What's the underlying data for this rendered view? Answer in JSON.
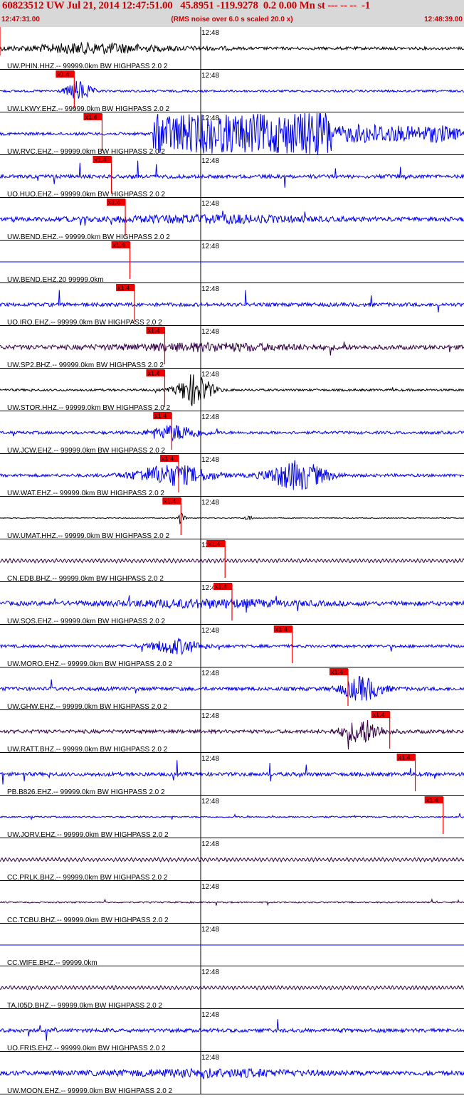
{
  "header": {
    "title": "60823512 UW Jul 21, 2014 12:47:51.00   45.8951 -119.9278  0.2 0.00 Mn st --- -- --  -1",
    "start_time": "12:47:31.00",
    "rms_note": "(RMS noise over 6.0 s scaled 20.0 x)",
    "end_time": "12:48:39.00",
    "background": "#d8d8d8",
    "text_color": "#cc0000"
  },
  "minute_tick_label": "12:48",
  "pick_label": "x1.4",
  "colors": {
    "blue": "#0000ee",
    "black": "#000000",
    "purple": "#330044",
    "pick": "#ee0000",
    "grid": "#000000"
  },
  "traces": [
    {
      "label": "UW.PHIN.HHZ.-- 99999.0km BW  HIGHPASS  2.0  2",
      "color": "black",
      "pick": 0.0,
      "pick_label": false,
      "activity": "early"
    },
    {
      "label": "UW.LKWY.EHZ.-- 99999.0km BW  HIGHPASS  2.0  2",
      "color": "blue",
      "pick": 0.16,
      "pick_label": true,
      "activity": "burst"
    },
    {
      "label": "UW.RVC.EHZ.-- 99999.0km BW  HIGHPASS  2.0  2",
      "color": "blue",
      "pick": 0.22,
      "pick_label": true,
      "activity": "large"
    },
    {
      "label": "UO.HUO.EHZ.-- 99999.0km BW  HIGHPASS  2.0  2",
      "color": "blue",
      "pick": 0.24,
      "pick_label": true,
      "activity": "spiky"
    },
    {
      "label": "UW.BEND.EHZ.-- 99999.0km BW  HIGHPASS  2.0  2",
      "color": "blue",
      "pick": 0.27,
      "pick_label": true,
      "activity": "moderate"
    },
    {
      "label": "UW.BEND.EHZ.20 99999.0km",
      "color": "blue",
      "pick": 0.28,
      "pick_label": true,
      "activity": "flat"
    },
    {
      "label": "UO.IRO.EHZ.-- 99999.0km BW  HIGHPASS  2.0  2",
      "color": "blue",
      "pick": 0.29,
      "pick_label": true,
      "activity": "spiky"
    },
    {
      "label": "UW.SP2.BHZ.-- 99999.0km BW  HIGHPASS  2.0  2",
      "color": "purple",
      "pick": 0.355,
      "pick_label": true,
      "activity": "moderate"
    },
    {
      "label": "UW.STOR.HHZ.-- 99999.0km BW  HIGHPASS  2.0  2",
      "color": "black",
      "pick": 0.355,
      "pick_label": true,
      "activity": "event"
    },
    {
      "label": "UW.JCW.EHZ.-- 99999.0km BW  HIGHPASS  2.0  2",
      "color": "blue",
      "pick": 0.37,
      "pick_label": true,
      "activity": "event-small"
    },
    {
      "label": "UW.WAT.EHZ.-- 99999.0km BW  HIGHPASS  2.0  2",
      "color": "blue",
      "pick": 0.385,
      "pick_label": true,
      "activity": "large-mid"
    },
    {
      "label": "UW.UMAT.HHZ.-- 99999.0km BW  HIGHPASS  2.0  2",
      "color": "black",
      "pick": 0.39,
      "pick_label": true,
      "activity": "blip"
    },
    {
      "label": "CN.EDB.BHZ.-- 99999.0km BW  HIGHPASS  2.0  2",
      "color": "purple",
      "pick": 0.485,
      "pick_label": true,
      "activity": "wavy"
    },
    {
      "label": "UW.SQS.EHZ.-- 99999.0km BW  HIGHPASS  2.0  2",
      "color": "blue",
      "pick": 0.5,
      "pick_label": true,
      "activity": "moderate"
    },
    {
      "label": "UW.MORO.EHZ.-- 99999.0km BW  HIGHPASS  2.0  2",
      "color": "blue",
      "pick": 0.63,
      "pick_label": true,
      "activity": "event-small"
    },
    {
      "label": "UW.GHW.EHZ.-- 99999.0km BW  HIGHPASS  2.0  2",
      "color": "blue",
      "pick": 0.75,
      "pick_label": true,
      "activity": "event-late"
    },
    {
      "label": "UW.RATT.BHZ.-- 99999.0km BW  HIGHPASS  2.0  2",
      "color": "purple",
      "pick": 0.84,
      "pick_label": true,
      "activity": "event-late"
    },
    {
      "label": "PB.B826.EHZ.-- 99999.0km BW  HIGHPASS  2.0  2",
      "color": "blue",
      "pick": 0.895,
      "pick_label": true,
      "activity": "spiky"
    },
    {
      "label": "UW.JORV.EHZ.-- 99999.0km BW  HIGHPASS  2.0  2",
      "color": "blue",
      "pick": 0.955,
      "pick_label": true,
      "activity": "quiet"
    },
    {
      "label": "CC.PRLK.BHZ.-- 99999.0km BW  HIGHPASS  2.0  2",
      "color": "purple",
      "pick": null,
      "pick_label": false,
      "activity": "wavy"
    },
    {
      "label": "CC.TCBU.BHZ.-- 99999.0km BW  HIGHPASS  2.0  2",
      "color": "purple",
      "pick": null,
      "pick_label": false,
      "activity": "quiet"
    },
    {
      "label": "CC.WIFE.BHZ.-- 99999.0km",
      "color": "blue",
      "pick": null,
      "pick_label": false,
      "activity": "flat"
    },
    {
      "label": "TA.I05D.BHZ.-- 99999.0km BW  HIGHPASS  2.0  2",
      "color": "purple",
      "pick": null,
      "pick_label": false,
      "activity": "wavy"
    },
    {
      "label": "UO.FRIS.EHZ.-- 99999.0km BW  HIGHPASS  2.0  2",
      "color": "blue",
      "pick": null,
      "pick_label": false,
      "activity": "spiky"
    },
    {
      "label": "UW.MOON.EHZ.-- 99999.0km BW  HIGHPASS  2.0  2",
      "color": "blue",
      "pick": null,
      "pick_label": false,
      "activity": "moderate"
    }
  ]
}
